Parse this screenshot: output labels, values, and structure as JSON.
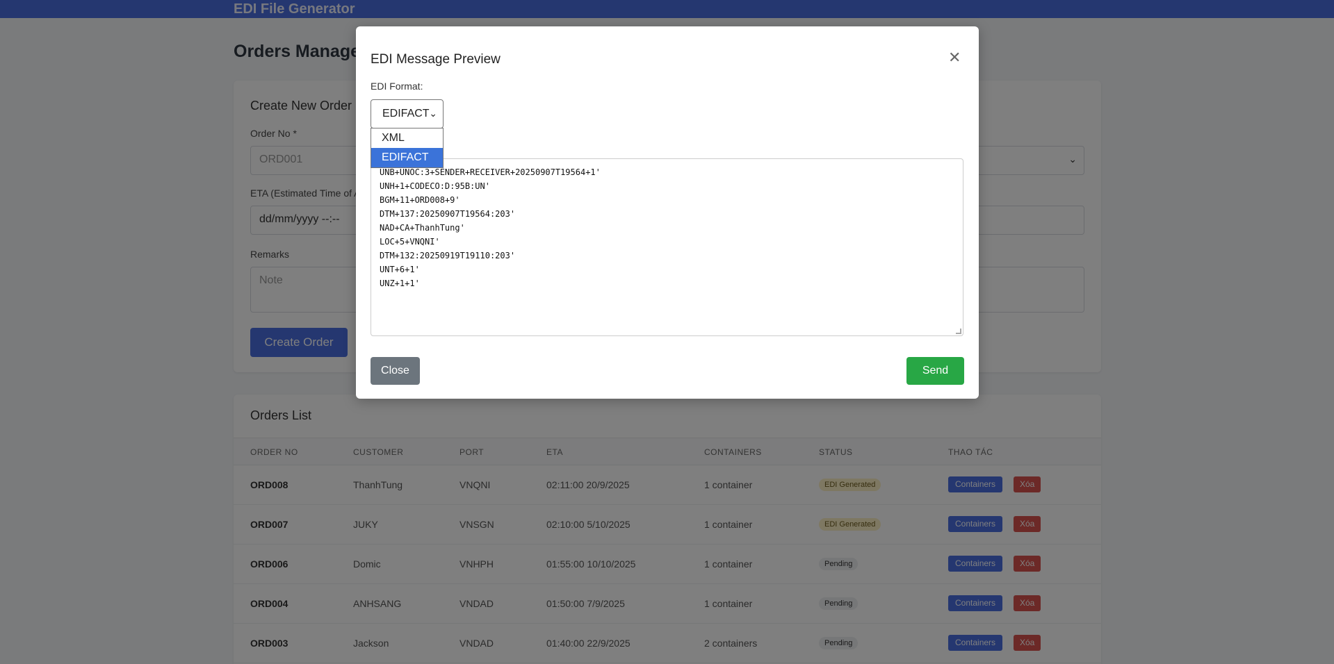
{
  "app": {
    "title": "EDI File Generator"
  },
  "page": {
    "title": "Orders Management"
  },
  "create": {
    "heading": "Create New Order",
    "order_no_label": "Order No *",
    "order_no_placeholder": "ORD001",
    "eta_label": "ETA (Estimated Time of Arrival)",
    "eta_placeholder": "dd/mm/yyyy --:--",
    "remarks_label": "Remarks",
    "remarks_placeholder": "Note",
    "submit_label": "Create Order"
  },
  "list": {
    "heading": "Orders List",
    "columns": [
      "ORDER NO",
      "CUSTOMER",
      "PORT",
      "ETA",
      "CONTAINERS",
      "STATUS",
      "THAO TÁC"
    ],
    "rows": [
      {
        "order_no": "ORD008",
        "customer": "ThanhTung",
        "port": "VNQNI",
        "eta": "02:11:00 20/9/2025",
        "containers": "1 container",
        "status": "EDI Generated",
        "containers_btn": "Containers",
        "delete_btn": "Xóa"
      },
      {
        "order_no": "ORD007",
        "customer": "JUKY",
        "port": "VNSGN",
        "eta": "02:10:00 5/10/2025",
        "containers": "1 container",
        "status": "EDI Generated",
        "containers_btn": "Containers",
        "delete_btn": "Xóa"
      },
      {
        "order_no": "ORD006",
        "customer": "Domic",
        "port": "VNHPH",
        "eta": "01:55:00 10/10/2025",
        "containers": "1 container",
        "status": "Pending",
        "containers_btn": "Containers",
        "delete_btn": "Xóa"
      },
      {
        "order_no": "ORD004",
        "customer": "ANHSANG",
        "port": "VNDAD",
        "eta": "01:50:00 7/9/2025",
        "containers": "1 container",
        "status": "Pending",
        "containers_btn": "Containers",
        "delete_btn": "Xóa"
      },
      {
        "order_no": "ORD003",
        "customer": "Jackson",
        "port": "VNDAD",
        "eta": "01:40:00 22/9/2025",
        "containers": "2 containers",
        "status": "Pending",
        "containers_btn": "Containers",
        "delete_btn": "Xóa"
      }
    ]
  },
  "modal": {
    "title": "EDI Message Preview",
    "close_icon": "close-icon",
    "format_label": "EDI Format:",
    "format_selected": "EDIFACT",
    "format_options": [
      "XML",
      "EDIFACT"
    ],
    "edi_lines": [
      "UNB+UNOC:3+SENDER+RECEIVER+20250907T19564+1'",
      "UNH+1+CODECO:D:95B:UN'",
      "BGM+11+ORD008+9'",
      "DTM+137:20250907T19564:203'",
      "NAD+CA+ThanhTung'",
      "LOC+5+VNQNI'",
      "DTM+132:20250919T19110:203'",
      "UNT+6+1'",
      "UNZ+1+1'"
    ],
    "close_label": "Close",
    "send_label": "Send"
  },
  "colors": {
    "accent": "#4a6ee0",
    "success": "#28a745",
    "danger": "#d9534f",
    "secondary": "#6c757d"
  }
}
